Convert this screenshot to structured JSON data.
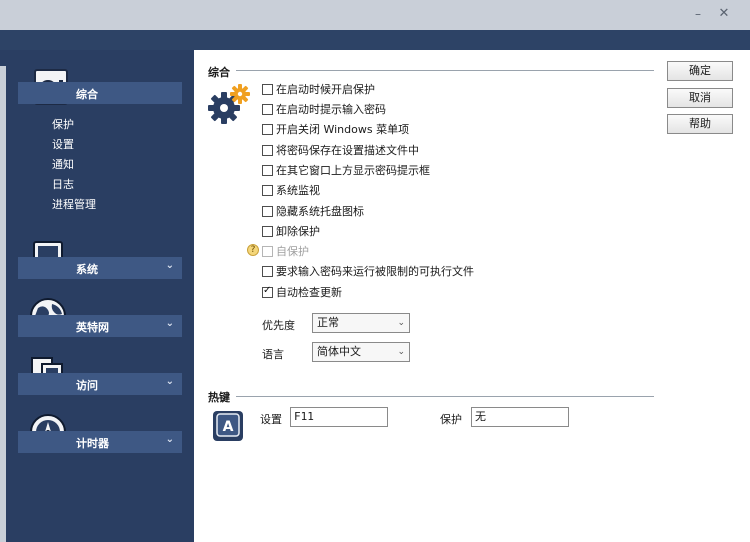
{
  "window": {
    "minimize_glyph": "–",
    "close_glyph": "✕"
  },
  "sidebar": {
    "groups": [
      {
        "label": "综合",
        "icon": "safe-icon",
        "expanded": true,
        "items": [
          "保护",
          "设置",
          "通知",
          "日志",
          "进程管理"
        ]
      },
      {
        "label": "系统",
        "icon": "computer-icon",
        "chevron": "⌄"
      },
      {
        "label": "英特网",
        "icon": "globe-icon",
        "chevron": "⌄"
      },
      {
        "label": "访问",
        "icon": "documents-icon",
        "chevron": "⌄"
      },
      {
        "label": "计时器",
        "icon": "compass-icon",
        "chevron": "⌄"
      }
    ]
  },
  "general": {
    "title": "综合",
    "options": [
      {
        "label": "在启动时候开启保护",
        "checked": false,
        "disabled": false
      },
      {
        "label": "在启动时提示输入密码",
        "checked": false,
        "disabled": false
      },
      {
        "label": "开启关闭 Windows 菜单项",
        "checked": false,
        "disabled": false
      },
      {
        "label": "将密码保存在设置描述文件中",
        "checked": false,
        "disabled": false
      },
      {
        "label": "在其它窗口上方显示密码提示框",
        "checked": false,
        "disabled": false
      },
      {
        "label": "系统监视",
        "checked": false,
        "disabled": false
      },
      {
        "label": "隐藏系统托盘图标",
        "checked": false,
        "disabled": false
      },
      {
        "label": "卸除保护",
        "checked": false,
        "disabled": false
      },
      {
        "label": "自保护",
        "checked": false,
        "disabled": true
      },
      {
        "label": "要求输入密码来运行被限制的可执行文件",
        "checked": false,
        "disabled": false
      },
      {
        "label": "自动检查更新",
        "checked": true,
        "disabled": false
      }
    ],
    "priority": {
      "label": "优先度",
      "value": "正常"
    },
    "language": {
      "label": "语言",
      "value": "简体中文"
    }
  },
  "hotkeys": {
    "title": "热键",
    "settings_label": "设置",
    "settings_value": "F11",
    "protect_label": "保护",
    "protect_value": "无"
  },
  "buttons": {
    "ok": "确定",
    "cancel": "取消",
    "help": "帮助"
  },
  "colors": {
    "sidebar": "#2a3e62",
    "sidebar_header": "#3e5884",
    "accent_gear": "#f0a021"
  }
}
